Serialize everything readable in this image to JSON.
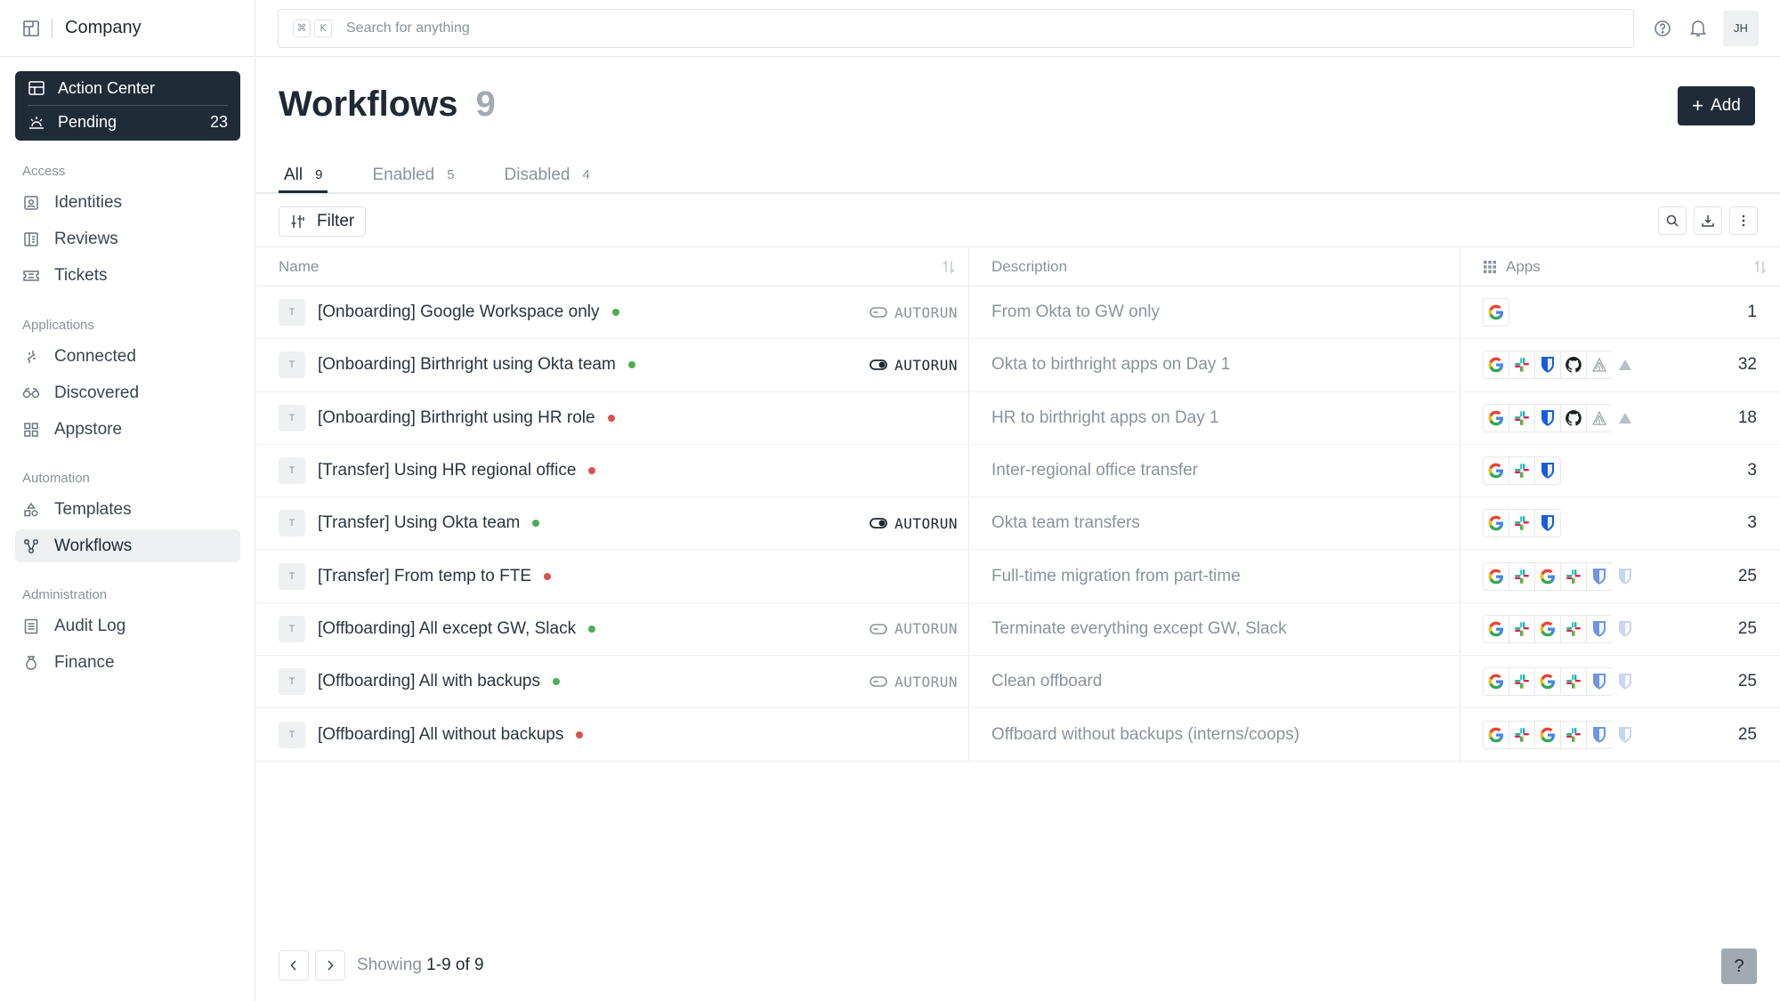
{
  "brand": {
    "name": "Company",
    "logo_icon": "company-logo-icon"
  },
  "action_center": {
    "title": "Action Center",
    "pending_label": "Pending",
    "pending_count": "23"
  },
  "sidebar": {
    "sections": [
      {
        "heading": "Access",
        "items": [
          {
            "label": "Identities",
            "icon": "id-card-icon"
          },
          {
            "label": "Reviews",
            "icon": "book-icon"
          },
          {
            "label": "Tickets",
            "icon": "ticket-icon"
          }
        ]
      },
      {
        "heading": "Applications",
        "items": [
          {
            "label": "Connected",
            "icon": "plug-icon"
          },
          {
            "label": "Discovered",
            "icon": "binoculars-icon"
          },
          {
            "label": "Appstore",
            "icon": "grid-icon"
          }
        ]
      },
      {
        "heading": "Automation",
        "items": [
          {
            "label": "Templates",
            "icon": "shapes-icon"
          },
          {
            "label": "Workflows",
            "icon": "workflow-icon",
            "active": true
          }
        ]
      },
      {
        "heading": "Administration",
        "items": [
          {
            "label": "Audit Log",
            "icon": "list-icon"
          },
          {
            "label": "Finance",
            "icon": "money-bag-icon"
          }
        ]
      }
    ]
  },
  "search": {
    "placeholder": "Search for anything",
    "kbd1": "⌘",
    "kbd2": "K"
  },
  "user": {
    "initials": "JH"
  },
  "page": {
    "title": "Workflows",
    "count": "9",
    "add_label": "Add"
  },
  "tabs": [
    {
      "label": "All",
      "count": "9",
      "active": true
    },
    {
      "label": "Enabled",
      "count": "5"
    },
    {
      "label": "Disabled",
      "count": "4"
    }
  ],
  "toolbar": {
    "filter_label": "Filter"
  },
  "table": {
    "headers": {
      "name": "Name",
      "description": "Description",
      "apps": "Apps"
    },
    "type_badge": "T",
    "autorun_label": "AUTORUN",
    "colors": {
      "enabled": "#4caf50",
      "disabled": "#d9534f"
    },
    "rows": [
      {
        "name": "[Onboarding] Google Workspace only",
        "status": "enabled",
        "autorun": "off",
        "description": "From Okta to GW only",
        "apps": [
          "google"
        ],
        "app_count": "1"
      },
      {
        "name": "[Onboarding] Birthright using Okta team",
        "status": "enabled",
        "autorun": "on",
        "description": "Okta to birthright apps on Day 1",
        "apps": [
          "google",
          "slack",
          "bitwarden",
          "github",
          "atlassian",
          "triangle"
        ],
        "app_count": "32"
      },
      {
        "name": "[Onboarding] Birthright using HR role",
        "status": "disabled",
        "autorun": "none",
        "description": "HR to birthright apps on Day 1",
        "apps": [
          "google",
          "slack",
          "bitwarden",
          "github",
          "atlassian",
          "triangle"
        ],
        "app_count": "18"
      },
      {
        "name": "[Transfer] Using HR regional office",
        "status": "disabled",
        "autorun": "none",
        "description": "Inter-regional office transfer",
        "apps": [
          "google",
          "slack",
          "bitwarden"
        ],
        "app_count": "3"
      },
      {
        "name": "[Transfer] Using Okta team",
        "status": "enabled",
        "autorun": "on",
        "description": "Okta team transfers",
        "apps": [
          "google",
          "slack",
          "bitwarden"
        ],
        "app_count": "3"
      },
      {
        "name": "[Transfer] From temp to FTE",
        "status": "disabled",
        "autorun": "none",
        "description": "Full-time migration from part-time",
        "apps": [
          "google",
          "slack",
          "google",
          "slack",
          "bitwarden-light",
          "bitwarden-faint"
        ],
        "app_count": "25"
      },
      {
        "name": "[Offboarding] All except GW, Slack",
        "status": "enabled",
        "autorun": "off",
        "description": "Terminate everything except GW, Slack",
        "apps": [
          "google",
          "slack",
          "google",
          "slack",
          "bitwarden-light",
          "bitwarden-faint"
        ],
        "app_count": "25"
      },
      {
        "name": "[Offboarding] All with backups",
        "status": "enabled",
        "autorun": "off",
        "description": "Clean offboard",
        "apps": [
          "google",
          "slack",
          "google",
          "slack",
          "bitwarden-light",
          "bitwarden-faint"
        ],
        "app_count": "25"
      },
      {
        "name": "[Offboarding] All without backups",
        "status": "disabled",
        "autorun": "none",
        "description": "Offboard without backups (interns/coops)",
        "apps": [
          "google",
          "slack",
          "google",
          "slack",
          "bitwarden-light",
          "bitwarden-faint"
        ],
        "app_count": "25"
      }
    ]
  },
  "pagination": {
    "showing_label": "Showing",
    "range": "1-9 of 9"
  },
  "help": {
    "label": "?"
  }
}
